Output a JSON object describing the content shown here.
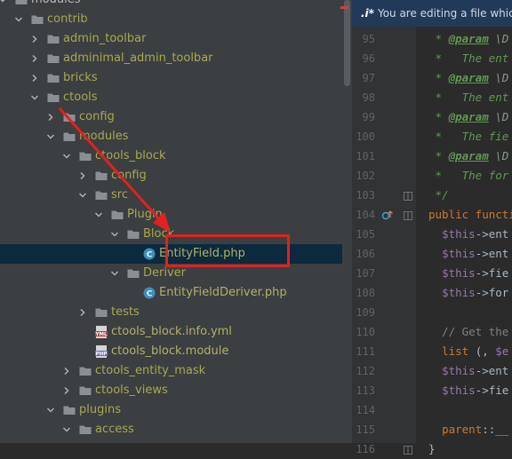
{
  "tree": {
    "rows": [
      {
        "label": "modules",
        "kind": "folder",
        "depth": 2,
        "expanded": true,
        "style": "folder"
      },
      {
        "label": "contrib",
        "kind": "folder",
        "depth": 3,
        "expanded": true,
        "style": "excluded"
      },
      {
        "label": "admin_toolbar",
        "kind": "folder",
        "depth": 4,
        "expanded": false,
        "style": "excluded"
      },
      {
        "label": "adminimal_admin_toolbar",
        "kind": "folder",
        "depth": 4,
        "expanded": false,
        "style": "excluded"
      },
      {
        "label": "bricks",
        "kind": "folder",
        "depth": 4,
        "expanded": false,
        "style": "excluded"
      },
      {
        "label": "ctools",
        "kind": "folder",
        "depth": 4,
        "expanded": true,
        "style": "excluded"
      },
      {
        "label": "config",
        "kind": "folder",
        "depth": 5,
        "expanded": false,
        "style": "excluded"
      },
      {
        "label": "modules",
        "kind": "folder",
        "depth": 5,
        "expanded": true,
        "style": "excluded"
      },
      {
        "label": "ctools_block",
        "kind": "folder",
        "depth": 6,
        "expanded": true,
        "style": "excluded"
      },
      {
        "label": "config",
        "kind": "folder",
        "depth": 7,
        "expanded": false,
        "style": "excluded"
      },
      {
        "label": "src",
        "kind": "folder",
        "depth": 7,
        "expanded": true,
        "style": "excluded"
      },
      {
        "label": "Plugin",
        "kind": "folder",
        "depth": 8,
        "expanded": true,
        "style": "excluded"
      },
      {
        "label": "Block",
        "kind": "folder",
        "depth": 9,
        "expanded": true,
        "style": "excluded"
      },
      {
        "label": "EntityField.php",
        "kind": "class",
        "depth": 10,
        "style": "file",
        "selected": true
      },
      {
        "label": "Deriver",
        "kind": "folder",
        "depth": 9,
        "expanded": true,
        "style": "excluded"
      },
      {
        "label": "EntityFieldDeriver.php",
        "kind": "class",
        "depth": 10,
        "style": "file"
      },
      {
        "label": "tests",
        "kind": "folder",
        "depth": 7,
        "expanded": false,
        "style": "excluded"
      },
      {
        "label": "ctools_block.info.yml",
        "kind": "yml",
        "depth": 7,
        "style": "file"
      },
      {
        "label": "ctools_block.module",
        "kind": "php",
        "depth": 7,
        "style": "file"
      },
      {
        "label": "ctools_entity_mask",
        "kind": "folder",
        "depth": 6,
        "expanded": false,
        "style": "excluded"
      },
      {
        "label": "ctools_views",
        "kind": "folder",
        "depth": 6,
        "expanded": false,
        "style": "excluded"
      },
      {
        "label": "plugins",
        "kind": "folder",
        "depth": 5,
        "expanded": true,
        "style": "excluded"
      },
      {
        "label": "access",
        "kind": "folder",
        "depth": 6,
        "expanded": true,
        "style": "excluded"
      },
      {
        "label": "",
        "kind": "folder",
        "depth": 7,
        "expanded": false,
        "style": "excluded"
      }
    ],
    "icon_badges": {
      "yml": "YML",
      "php": "PHP",
      "class": "C"
    }
  },
  "editor": {
    "notice": {
      "prefix": ".i*",
      "text": "You are editing a file which"
    },
    "lines": [
      {
        "num": "95",
        "tokens": [
          {
            "t": " * ",
            "c": "doc"
          },
          {
            "t": "@param",
            "c": "tag"
          },
          {
            "t": " \\D",
            "c": "type"
          }
        ]
      },
      {
        "num": "96",
        "tokens": [
          {
            "t": " *   The ent",
            "c": "doc"
          }
        ]
      },
      {
        "num": "97",
        "tokens": [
          {
            "t": " * ",
            "c": "doc"
          },
          {
            "t": "@param",
            "c": "tag"
          },
          {
            "t": " \\D",
            "c": "type"
          }
        ]
      },
      {
        "num": "98",
        "tokens": [
          {
            "t": " *   The ent",
            "c": "doc"
          }
        ]
      },
      {
        "num": "99",
        "tokens": [
          {
            "t": " * ",
            "c": "doc"
          },
          {
            "t": "@param",
            "c": "tag"
          },
          {
            "t": " \\D",
            "c": "type"
          }
        ]
      },
      {
        "num": "100",
        "tokens": [
          {
            "t": " *   The fie",
            "c": "doc"
          }
        ]
      },
      {
        "num": "101",
        "tokens": [
          {
            "t": " * ",
            "c": "doc"
          },
          {
            "t": "@param",
            "c": "tag"
          },
          {
            "t": " \\D",
            "c": "type"
          }
        ]
      },
      {
        "num": "102",
        "tokens": [
          {
            "t": " *   The for",
            "c": "doc"
          }
        ]
      },
      {
        "num": "103",
        "tokens": [
          {
            "t": " */",
            "c": "doc"
          }
        ]
      },
      {
        "num": "104",
        "tokens": [
          {
            "t": "public functi",
            "c": "kw"
          }
        ]
      },
      {
        "num": "105",
        "tokens": [
          {
            "t": "  ",
            "c": "plain"
          },
          {
            "t": "$this",
            "c": "var"
          },
          {
            "t": "->ent",
            "c": "plain"
          }
        ]
      },
      {
        "num": "106",
        "tokens": [
          {
            "t": "  ",
            "c": "plain"
          },
          {
            "t": "$this",
            "c": "var"
          },
          {
            "t": "->ent",
            "c": "plain"
          }
        ]
      },
      {
        "num": "107",
        "tokens": [
          {
            "t": "  ",
            "c": "plain"
          },
          {
            "t": "$this",
            "c": "var"
          },
          {
            "t": "->fie",
            "c": "plain"
          }
        ]
      },
      {
        "num": "108",
        "tokens": [
          {
            "t": "  ",
            "c": "plain"
          },
          {
            "t": "$this",
            "c": "var"
          },
          {
            "t": "->for",
            "c": "plain"
          }
        ]
      },
      {
        "num": "109",
        "tokens": []
      },
      {
        "num": "110",
        "tokens": [
          {
            "t": "  // Get the",
            "c": "cmt"
          }
        ]
      },
      {
        "num": "111",
        "tokens": [
          {
            "t": "  ",
            "c": "plain"
          },
          {
            "t": "list",
            "c": "kw"
          },
          {
            "t": " (, ",
            "c": "plain"
          },
          {
            "t": "$e",
            "c": "var"
          }
        ]
      },
      {
        "num": "112",
        "tokens": [
          {
            "t": "  ",
            "c": "plain"
          },
          {
            "t": "$this",
            "c": "var"
          },
          {
            "t": "->ent",
            "c": "plain"
          }
        ]
      },
      {
        "num": "113",
        "tokens": [
          {
            "t": "  ",
            "c": "plain"
          },
          {
            "t": "$this",
            "c": "var"
          },
          {
            "t": "->fie",
            "c": "plain"
          }
        ]
      },
      {
        "num": "114",
        "tokens": []
      },
      {
        "num": "115",
        "tokens": [
          {
            "t": "  ",
            "c": "plain"
          },
          {
            "t": "parent",
            "c": "kw"
          },
          {
            "t": "::__",
            "c": "plain"
          }
        ]
      },
      {
        "num": "116",
        "tokens": [
          {
            "t": "}",
            "c": "plain"
          }
        ]
      }
    ]
  },
  "colors": {
    "tree_bg": "#3c3f41",
    "selection": "#0d293e",
    "folder_icon": "#8a8f93",
    "annotation_red": "#e32020",
    "class_icon": "#4a9ec4"
  },
  "icons": {
    "expanded": "chevron-down-icon",
    "collapsed": "chevron-right-icon",
    "folder": "folder-icon",
    "class": "php-class-icon",
    "yml": "yml-file-icon",
    "php": "php-file-icon",
    "override": "override-gutter-icon",
    "fold": "fold-marker-icon"
  }
}
